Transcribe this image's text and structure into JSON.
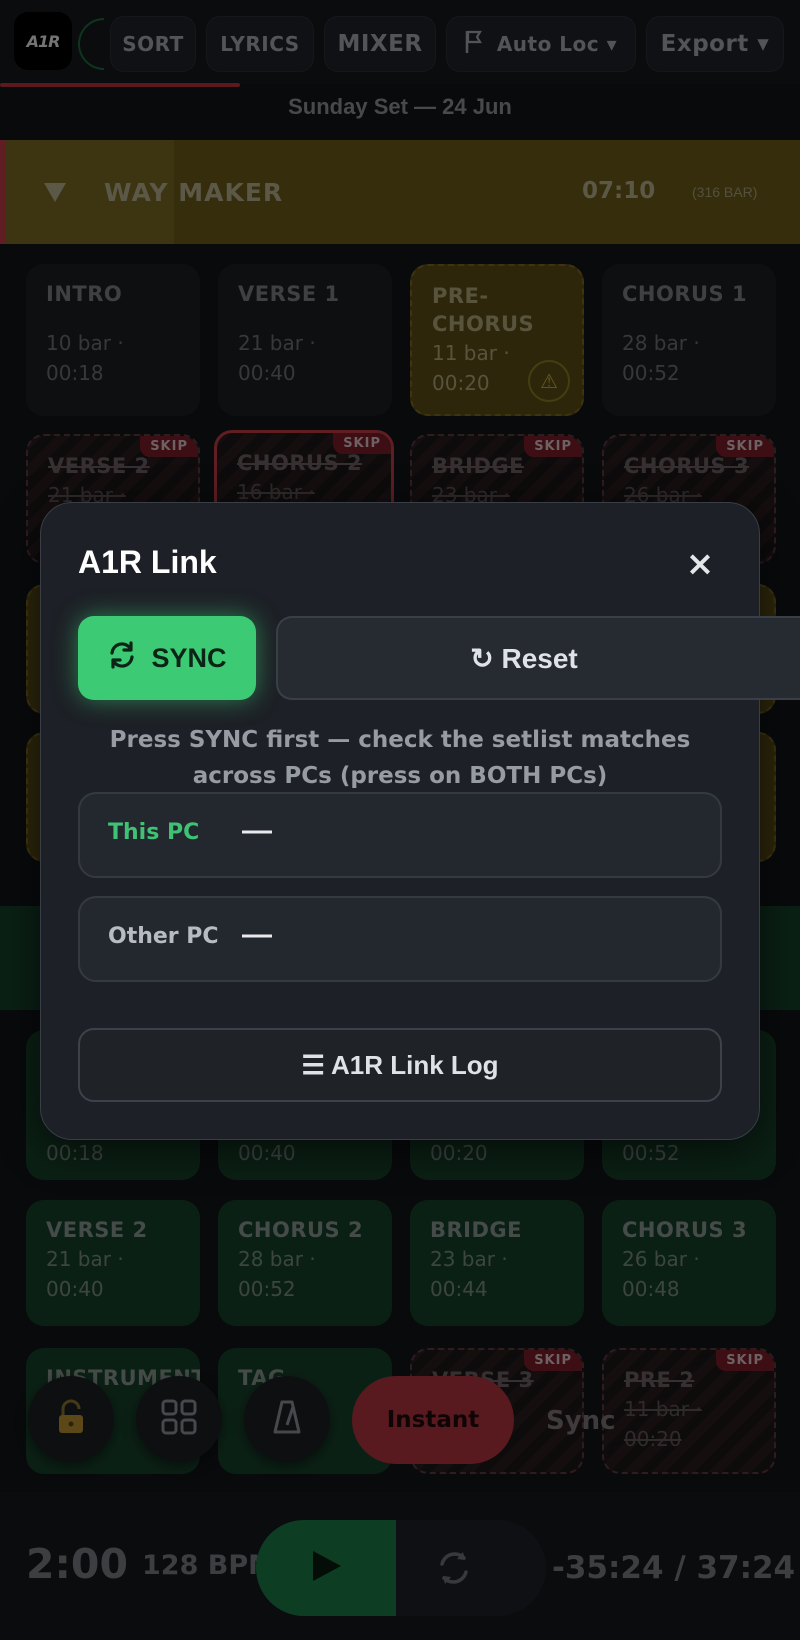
{
  "topbar": {
    "logo_text": "A1R",
    "sort": "SORT",
    "lyrics": "LYRICS",
    "mixer": "MIXER",
    "autoloc": "Auto Loc ▾",
    "export": "Export ▾",
    "set_name": "Sunday Set — 24 Jun"
  },
  "song1": {
    "title": "WAY MAKER",
    "time": "07:10",
    "bars": "(316 BAR)",
    "sections": [
      {
        "name": "INTRO",
        "meta1": "10 bar ·",
        "meta2": "00:18"
      },
      {
        "name": "VERSE 1",
        "meta1": "21 bar ·",
        "meta2": "00:40"
      },
      {
        "name": "PRE-CHORUS",
        "meta1": "11 bar ·",
        "meta2": "00:20"
      },
      {
        "name": "CHORUS 1",
        "meta1": "28 bar ·",
        "meta2": "00:52"
      },
      {
        "name": "VERSE 2",
        "meta1": "21 bar ·"
      },
      {
        "name": "CHORUS 2",
        "meta1": "16 bar ·"
      },
      {
        "name": "BRIDGE",
        "meta1": "23 bar ·"
      },
      {
        "name": "CHORUS 3",
        "meta1": "26 bar ·"
      }
    ],
    "skip_label": "SKIP"
  },
  "song2": {
    "sections": [
      {
        "meta2": "00:18"
      },
      {
        "meta2": "00:40"
      },
      {
        "meta2": "00:20"
      },
      {
        "meta2": "00:52"
      },
      {
        "name": "VERSE 2",
        "meta1": "21 bar ·",
        "meta2": "00:40"
      },
      {
        "name": "CHORUS 2",
        "meta1": "28 bar ·",
        "meta2": "00:52"
      },
      {
        "name": "BRIDGE",
        "meta1": "23 bar ·",
        "meta2": "00:44"
      },
      {
        "name": "CHORUS 3",
        "meta1": "26 bar ·",
        "meta2": "00:48"
      },
      {
        "name": "INSTRUMENT"
      },
      {
        "name": "TAG"
      },
      {
        "name": "VERSE 3"
      },
      {
        "name": "PRE 2",
        "meta1": "11 bar ·",
        "meta2": "00:20"
      }
    ]
  },
  "controls": {
    "instant": "Instant",
    "sync_ghost": "Sync"
  },
  "bottombar": {
    "clock": "2:00",
    "bpm": "128 BPM",
    "remaining": "-35:24 / 37:24"
  },
  "modal": {
    "title": "A1R Link",
    "close": "×",
    "sync_label": "SYNC",
    "reset_label": "↻ Reset",
    "hint": "Press SYNC first — check the setlist matches across PCs (press on BOTH PCs)",
    "this_pc_label": "This PC",
    "this_pc_value": "—",
    "other_pc_label": "Other PC",
    "other_pc_value": "—",
    "log_label": "☰ A1R Link Log"
  },
  "colors": {
    "accent_green": "#3ccb74",
    "accent_red": "#b2343e",
    "this_pc_green": "#3fc273"
  }
}
